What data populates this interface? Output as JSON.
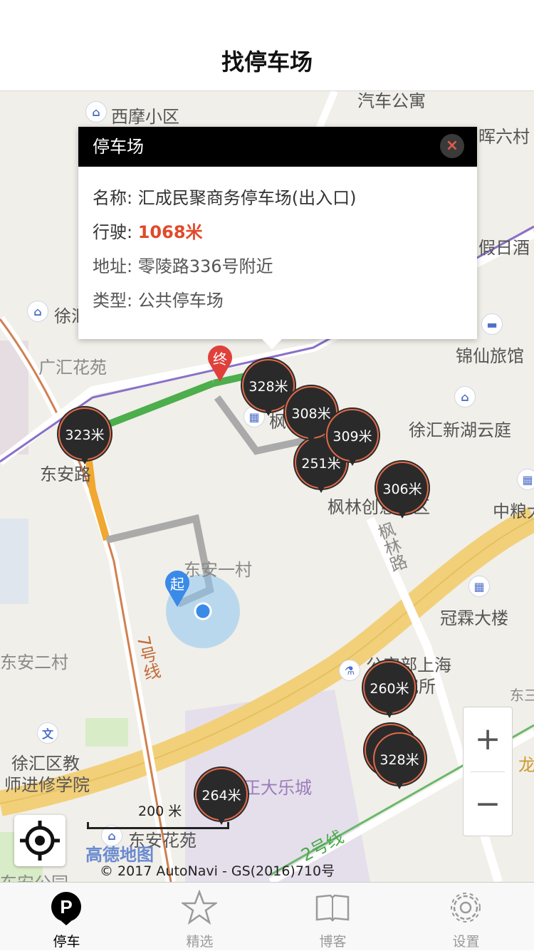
{
  "header": {
    "title": "找停车场"
  },
  "map": {
    "labels": {
      "xim": "西摩小区",
      "car_apt": "汽车公寓",
      "hui6": "晖六村",
      "holiday": "假日酒",
      "xu": "徐汇",
      "guanghui": "广汇花苑",
      "jinxian": "锦仙旅馆",
      "xujiahui_hy": "徐汇新湖云庭",
      "dongan_lu": "东安路",
      "fenglin": "枫林创意园区",
      "zhongliang": "中粮大",
      "fenglin_rd": "枫林路",
      "dongan1": "东安一村",
      "guanlin": "冠霖大楼",
      "dongan2": "东安二村",
      "police": "公安部上海",
      "police2": "研究所",
      "dongsan": "东三",
      "line7": "7号线",
      "teacher1": "徐汇区教",
      "teacher2": "师进修学院",
      "mall": "正大乐城",
      "donganhy": "东安花苑",
      "line2": "2号线",
      "long": "龙",
      "park": "东安公园",
      "fengqu": "枫",
      "start_marker": "起",
      "end_marker": "终"
    },
    "pins": [
      {
        "label": "323米"
      },
      {
        "label": "328米"
      },
      {
        "label": "308米"
      },
      {
        "label": "309米"
      },
      {
        "label": "251米"
      },
      {
        "label": "306米"
      },
      {
        "label": "260米"
      },
      {
        "label": "328米"
      },
      {
        "label": "264米"
      }
    ],
    "scale_label": "200 米",
    "brand": "高德地图",
    "copyright": "© 2017 AutoNavi - GS(2016)710号",
    "zoom_in": "+",
    "zoom_out": "−"
  },
  "popup": {
    "title": "停车场",
    "close_glyph": "×",
    "name_label": "名称: ",
    "name_value": "汇成民聚商务停车场(出入口)",
    "drive_label": "行驶: ",
    "drive_value": "1068米",
    "addr_label": "地址: ",
    "addr_value": "零陵路336号附近",
    "type_label": "类型: ",
    "type_value": "公共停车场"
  },
  "tabbar": {
    "items": [
      {
        "label": "停车",
        "icon": "parking-icon",
        "active": true
      },
      {
        "label": "精选",
        "icon": "star-icon",
        "active": false
      },
      {
        "label": "博客",
        "icon": "book-icon",
        "active": false
      },
      {
        "label": "设置",
        "icon": "gear-icon",
        "active": false
      }
    ]
  },
  "colors": {
    "route_green": "#4cae4c",
    "route_orange": "#f0a830",
    "pin_ring": "#e06a4a",
    "highlight_red": "#e04a2a"
  }
}
